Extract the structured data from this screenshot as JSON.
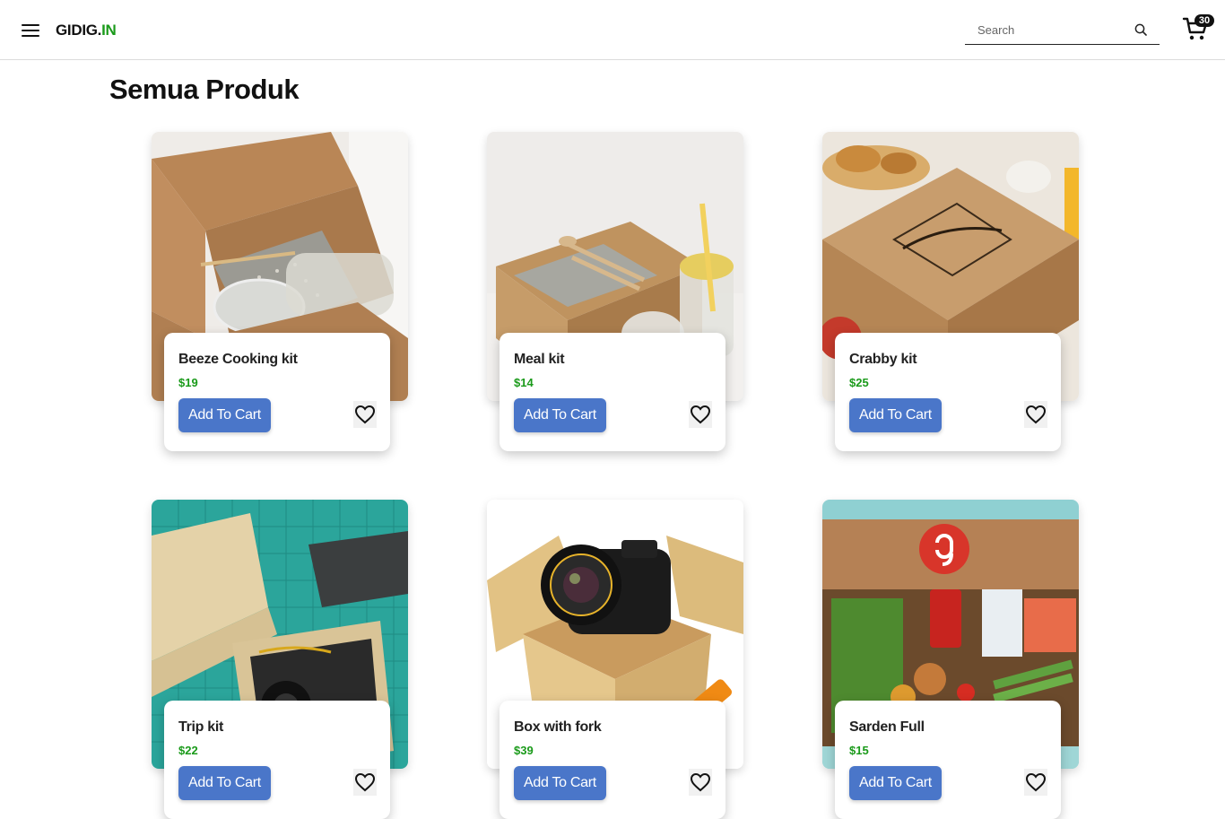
{
  "header": {
    "logo_main": "GIDIG.",
    "logo_accent": "IN",
    "search_placeholder": "Search",
    "cart_count": "30"
  },
  "page": {
    "title": "Semua Produk"
  },
  "products": [
    {
      "name": "Beeze Cooking kit",
      "price": "$19",
      "button": "Add To Cart"
    },
    {
      "name": "Meal kit",
      "price": "$14",
      "button": "Add To Cart"
    },
    {
      "name": "Crabby kit",
      "price": "$25",
      "button": "Add To Cart"
    },
    {
      "name": "Trip kit",
      "price": "$22",
      "button": "Add To Cart"
    },
    {
      "name": "Box with fork",
      "price": "$39",
      "button": "Add To Cart"
    },
    {
      "name": "Sarden Full",
      "price": "$15",
      "button": "Add To Cart"
    }
  ],
  "colors": {
    "accent": "#1a9a1a",
    "button": "#4a76c9",
    "badge": "#111111"
  }
}
